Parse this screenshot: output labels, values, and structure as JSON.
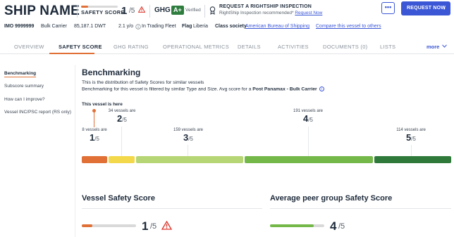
{
  "header": {
    "ship_name": "SHIP NAME",
    "safety_score_label": "SAFETY SCORE",
    "safety_score_value": "1",
    "safety_score_denominator": "/5",
    "safety_score_fill_fraction": 0.2,
    "safety_score_color": "#e07036",
    "ghg_label": "GHG",
    "ghg_rating": "A+",
    "ghg_color": "#2e7d3e",
    "ghg_verified": "Verified",
    "inspection_title": "REQUEST A RIGHTSHIP INSPECTION",
    "inspection_text": "RightShip Inspection recommended*",
    "inspection_link": "Request Now",
    "more_button": "•••",
    "request_button": "REQUEST NOW",
    "request_chevron": "›",
    "accent_color": "#3b57d6"
  },
  "meta": {
    "imo": "IMO 9999999",
    "type": "Bulk Carrier",
    "dwt": "85,187.1 DWT",
    "age": "2.1 y/o",
    "status": "In Trading Fleet",
    "flag_label": "Flag",
    "flag_value": "Liberia",
    "class_label": "Class society",
    "class_value": "American Bureau of Shipping",
    "compare_link": "Compare this vessel to others"
  },
  "tabs": {
    "overview": "OVERVIEW",
    "safety_score": "SAFETY SCORE",
    "ghg_rating": "GHG RATING",
    "operational_metrics": "OPERATIONAL METRICS",
    "details": "DETAILS",
    "activities": "ACTIVITIES",
    "documents": "DOCUMENTS (0)",
    "lists": "LISTS",
    "more": "more"
  },
  "sidebar": {
    "items": [
      {
        "label": "Benchmarking"
      },
      {
        "label": "Subscore summary"
      },
      {
        "label": "How can I improve?"
      },
      {
        "label": "Vessel INC/PSC report (RS only)"
      }
    ]
  },
  "benchmarking": {
    "title": "Benchmarking",
    "line1": "This is the distribution of Safety Scores for similar vessels",
    "line2_prefix": "Benchmarking for this vessel is filtered by similar Type and Size. Avg score for a ",
    "line2_bold": "Post Panamax - Bulk Carrier",
    "this_vessel": "This vessel is here",
    "groups": [
      {
        "count": "8 vessels are",
        "score": "1",
        "den": "/5"
      },
      {
        "count": "34 vessels are",
        "score": "2",
        "den": "/5"
      },
      {
        "count": "159 vessels are",
        "score": "3",
        "den": "/5"
      },
      {
        "count": "191 vessels are",
        "score": "4",
        "den": "/5"
      },
      {
        "count": "114 vessels are",
        "score": "5",
        "den": "/5"
      }
    ],
    "bar_colors": [
      "#e07036",
      "#f2d84a",
      "#b6d574",
      "#74b84a",
      "#2f7a3a"
    ]
  },
  "vessel_safety": {
    "title": "Vessel Safety Score",
    "score": "1",
    "den": "/5",
    "fill_fraction": 0.2
  },
  "peer_safety": {
    "title": "Average peer group Safety Score",
    "score": "4",
    "den": "/5",
    "fill_fraction": 0.8,
    "color": "#74b84a"
  }
}
